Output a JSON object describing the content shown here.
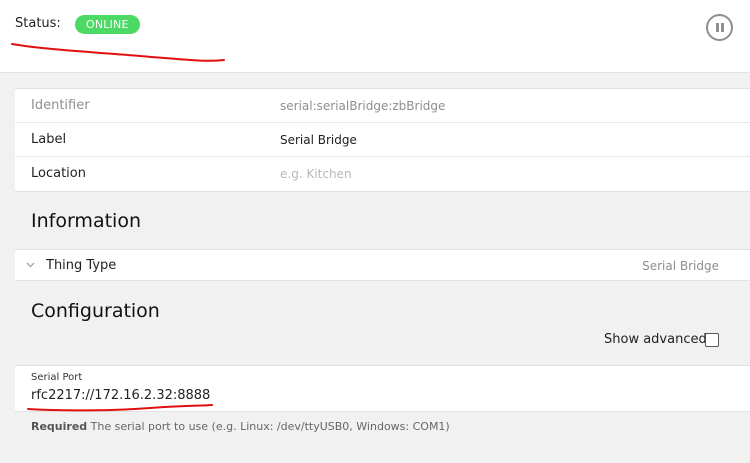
{
  "header": {
    "status_label": "Status:",
    "status_value": "ONLINE",
    "status_color": "#4cd964",
    "pause_icon": "pause-icon"
  },
  "properties": [
    {
      "key": "Identifier",
      "value": "serial:serialBridge:zbBridge"
    },
    {
      "key": "Label",
      "value": "Serial Bridge"
    },
    {
      "key": "Location",
      "placeholder": "e.g. Kitchen"
    }
  ],
  "information": {
    "title": "Information",
    "thing_type_label": "Thing Type",
    "thing_type_value": "Serial Bridge"
  },
  "configuration": {
    "title": "Configuration",
    "show_advanced_label": "Show advanced",
    "show_advanced_checked": false,
    "serial_port": {
      "label": "Serial Port",
      "value": "rfc2217://172.16.2.32:8888",
      "hint_required": "Required",
      "hint_text": "The serial port to use (e.g. Linux: /dev/ttyUSB0, Windows: COM1)"
    }
  },
  "annotation_color": "#e01010"
}
